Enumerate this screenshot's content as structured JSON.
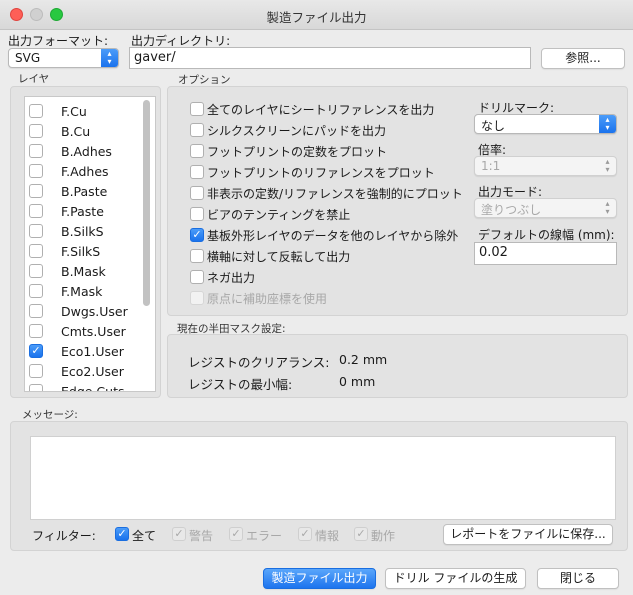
{
  "window": {
    "title": "製造ファイル出力"
  },
  "format": {
    "label": "出力フォーマット:",
    "value": "SVG"
  },
  "output_dir": {
    "label": "出力ディレクトリ:",
    "value": "gaver/",
    "browse_button": "参照..."
  },
  "layers": {
    "section_label": "レイヤ",
    "items": [
      {
        "name": "F.Cu",
        "checked": false
      },
      {
        "name": "B.Cu",
        "checked": false
      },
      {
        "name": "B.Adhes",
        "checked": false
      },
      {
        "name": "F.Adhes",
        "checked": false
      },
      {
        "name": "B.Paste",
        "checked": false
      },
      {
        "name": "F.Paste",
        "checked": false
      },
      {
        "name": "B.SilkS",
        "checked": false
      },
      {
        "name": "F.SilkS",
        "checked": false
      },
      {
        "name": "B.Mask",
        "checked": false
      },
      {
        "name": "F.Mask",
        "checked": false
      },
      {
        "name": "Dwgs.User",
        "checked": false
      },
      {
        "name": "Cmts.User",
        "checked": false
      },
      {
        "name": "Eco1.User",
        "checked": true
      },
      {
        "name": "Eco2.User",
        "checked": false
      },
      {
        "name": "Edge.Cuts",
        "checked": false
      }
    ]
  },
  "options": {
    "section_label": "オプション",
    "items": [
      {
        "label": "全てのレイヤにシートリファレンスを出力",
        "checked": false,
        "enabled": true
      },
      {
        "label": "シルクスクリーンにパッドを出力",
        "checked": false,
        "enabled": true
      },
      {
        "label": "フットプリントの定数をプロット",
        "checked": false,
        "enabled": true
      },
      {
        "label": "フットプリントのリファレンスをプロット",
        "checked": false,
        "enabled": true
      },
      {
        "label": "非表示の定数/リファレンスを強制的にプロット",
        "checked": false,
        "enabled": true
      },
      {
        "label": "ビアのテンティングを禁止",
        "checked": false,
        "enabled": true
      },
      {
        "label": "基板外形レイヤのデータを他のレイヤから除外",
        "checked": true,
        "enabled": true
      },
      {
        "label": "横軸に対して反転して出力",
        "checked": false,
        "enabled": true
      },
      {
        "label": "ネガ出力",
        "checked": false,
        "enabled": true
      },
      {
        "label": "原点に補助座標を使用",
        "checked": false,
        "enabled": false
      }
    ],
    "drill_marks": {
      "label": "ドリルマーク:",
      "value": "なし"
    },
    "scale": {
      "label": "倍率:",
      "value": "1:1"
    },
    "output_mode": {
      "label": "出力モード:",
      "value": "塗りつぶし"
    },
    "default_line_width": {
      "label": "デフォルトの線幅 (mm):",
      "value": "0.02"
    }
  },
  "solder_mask": {
    "section_label": "現在の半田マスク設定:",
    "clearance_label": "レジストのクリアランス:",
    "clearance_value": "0.2 mm",
    "min_width_label": "レジストの最小幅:",
    "min_width_value": "0 mm"
  },
  "messages": {
    "section_label": "メッセージ:",
    "filter_label": "フィルター:",
    "filters": [
      {
        "label": "全て",
        "checked": true,
        "enabled": true
      },
      {
        "label": "警告",
        "checked": true,
        "enabled": false
      },
      {
        "label": "エラー",
        "checked": true,
        "enabled": false
      },
      {
        "label": "情報",
        "checked": true,
        "enabled": false
      },
      {
        "label": "動作",
        "checked": true,
        "enabled": false
      }
    ],
    "save_report_button": "レポートをファイルに保存..."
  },
  "buttons": {
    "plot": "製造ファイル出力",
    "generate_drill": "ドリル ファイルの生成",
    "close": "閉じる"
  },
  "colors": {
    "accent": "#1a72ed",
    "close_light": "#fe5f57",
    "inactive_light": "#d0d0d0",
    "maximize_light": "#28c840"
  }
}
